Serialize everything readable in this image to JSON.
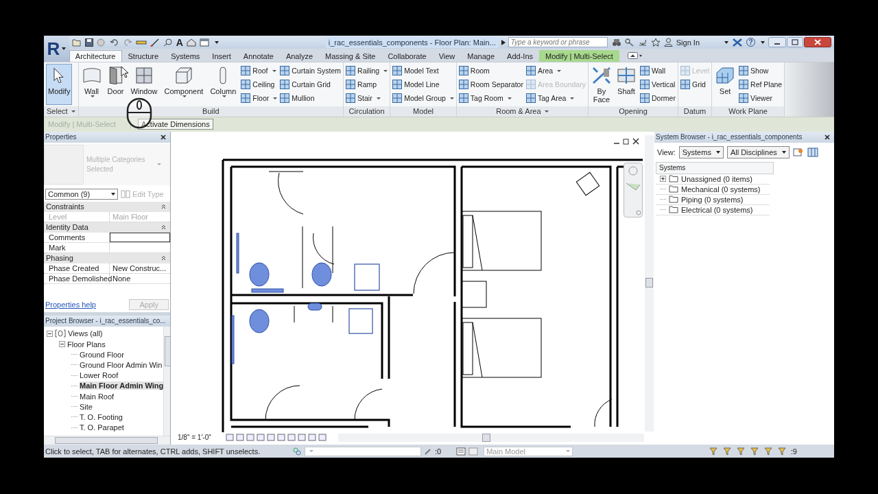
{
  "app": {
    "logo_letter": "R",
    "title": "i_rac_essentials_components - Floor Plan: Main...",
    "search": {
      "placeholder": "Type a keyword or phrase"
    },
    "sign_in": "Sign In",
    "text_tool_glyph": "A",
    "help_glyph": "?"
  },
  "tabs": [
    {
      "label": "Architecture",
      "selected": true,
      "kind": "normal"
    },
    {
      "label": "Structure",
      "selected": false,
      "kind": "normal"
    },
    {
      "label": "Systems",
      "selected": false,
      "kind": "normal"
    },
    {
      "label": "Insert",
      "selected": false,
      "kind": "normal"
    },
    {
      "label": "Annotate",
      "selected": false,
      "kind": "normal"
    },
    {
      "label": "Analyze",
      "selected": false,
      "kind": "normal"
    },
    {
      "label": "Massing & Site",
      "selected": false,
      "kind": "normal"
    },
    {
      "label": "Collaborate",
      "selected": false,
      "kind": "normal"
    },
    {
      "label": "View",
      "selected": false,
      "kind": "normal"
    },
    {
      "label": "Manage",
      "selected": false,
      "kind": "normal"
    },
    {
      "label": "Add-Ins",
      "selected": false,
      "kind": "normal"
    },
    {
      "label": "Modify | Multi-Select",
      "selected": false,
      "kind": "contextual"
    }
  ],
  "ribbon": {
    "panels": [
      {
        "title": "Select",
        "dropdown": true,
        "tools": [
          {
            "label": "Modify",
            "kind": "large",
            "dropdown": false,
            "selected": true,
            "disabled": false
          }
        ]
      },
      {
        "title": "Build",
        "dropdown": false,
        "tools": [
          {
            "label": "Wall",
            "kind": "large",
            "dropdown": true,
            "selected": false,
            "disabled": false
          },
          {
            "label": "Door",
            "kind": "large",
            "dropdown": false,
            "selected": false,
            "disabled": false
          },
          {
            "label": "Window",
            "kind": "large",
            "dropdown": false,
            "selected": false,
            "disabled": false
          },
          {
            "label": "Component",
            "kind": "large",
            "dropdown": true,
            "selected": false,
            "disabled": false
          },
          {
            "label": "Column",
            "kind": "large",
            "dropdown": true,
            "selected": false,
            "disabled": false
          },
          {
            "label": "Roof",
            "kind": "small",
            "dropdown": true,
            "selected": false,
            "disabled": false
          },
          {
            "label": "Ceiling",
            "kind": "small",
            "dropdown": false,
            "selected": false,
            "disabled": false
          },
          {
            "label": "Floor",
            "kind": "small",
            "dropdown": true,
            "selected": false,
            "disabled": false
          },
          {
            "label": "Curtain System",
            "kind": "small",
            "dropdown": false,
            "selected": false,
            "disabled": false
          },
          {
            "label": "Curtain Grid",
            "kind": "small",
            "dropdown": false,
            "selected": false,
            "disabled": false
          },
          {
            "label": "Mullion",
            "kind": "small",
            "dropdown": false,
            "selected": false,
            "disabled": false
          }
        ]
      },
      {
        "title": "Circulation",
        "dropdown": false,
        "tools": [
          {
            "label": "Railing",
            "kind": "small",
            "dropdown": true,
            "selected": false,
            "disabled": false
          },
          {
            "label": "Ramp",
            "kind": "small",
            "dropdown": false,
            "selected": false,
            "disabled": false
          },
          {
            "label": "Stair",
            "kind": "small",
            "dropdown": true,
            "selected": false,
            "disabled": false
          }
        ]
      },
      {
        "title": "Model",
        "dropdown": false,
        "tools": [
          {
            "label": "Model Text",
            "kind": "small",
            "dropdown": false,
            "selected": false,
            "disabled": false
          },
          {
            "label": "Model Line",
            "kind": "small",
            "dropdown": false,
            "selected": false,
            "disabled": false
          },
          {
            "label": "Model Group",
            "kind": "small",
            "dropdown": true,
            "selected": false,
            "disabled": false
          }
        ]
      },
      {
        "title": "Room & Area",
        "dropdown": true,
        "tools": [
          {
            "label": "Room",
            "kind": "small",
            "dropdown": false,
            "selected": false,
            "disabled": false
          },
          {
            "label": "Room Separator",
            "kind": "small",
            "dropdown": false,
            "selected": false,
            "disabled": false
          },
          {
            "label": "Tag Room",
            "kind": "small",
            "dropdown": true,
            "selected": false,
            "disabled": false
          },
          {
            "label": "Area",
            "kind": "small",
            "dropdown": true,
            "selected": false,
            "disabled": false
          },
          {
            "label": "Area Boundary",
            "kind": "small",
            "dropdown": false,
            "selected": false,
            "disabled": true
          },
          {
            "label": "Tag Area",
            "kind": "small",
            "dropdown": true,
            "selected": false,
            "disabled": false
          }
        ]
      },
      {
        "title": "Opening",
        "dropdown": false,
        "tools": [
          {
            "label": "By Face",
            "kind": "large",
            "dropdown": false,
            "selected": false,
            "disabled": false
          },
          {
            "label": "Shaft",
            "kind": "large",
            "dropdown": false,
            "selected": false,
            "disabled": false
          },
          {
            "label": "Wall",
            "kind": "small",
            "dropdown": false,
            "selected": false,
            "disabled": false
          },
          {
            "label": "Vertical",
            "kind": "small",
            "dropdown": false,
            "selected": false,
            "disabled": false
          },
          {
            "label": "Dormer",
            "kind": "small",
            "dropdown": false,
            "selected": false,
            "disabled": false
          }
        ]
      },
      {
        "title": "Datum",
        "dropdown": false,
        "tools": [
          {
            "label": "Level",
            "kind": "small",
            "dropdown": false,
            "selected": false,
            "disabled": true
          },
          {
            "label": "Grid",
            "kind": "small",
            "dropdown": false,
            "selected": false,
            "disabled": false
          }
        ]
      },
      {
        "title": "Work Plane",
        "dropdown": false,
        "tools": [
          {
            "label": "Set",
            "kind": "large",
            "dropdown": false,
            "selected": false,
            "disabled": false
          },
          {
            "label": "Show",
            "kind": "small",
            "dropdown": false,
            "selected": false,
            "disabled": false
          },
          {
            "label": "Ref Plane",
            "kind": "small",
            "dropdown": false,
            "selected": false,
            "disabled": false
          },
          {
            "label": "Viewer",
            "kind": "small",
            "dropdown": false,
            "selected": false,
            "disabled": false
          }
        ]
      }
    ]
  },
  "options_bar": {
    "context": "Modify | Multi-Select",
    "button": "Activate Dimensions"
  },
  "properties": {
    "title": "Properties",
    "type_name": "Multiple Categories Selected",
    "filter": "Common (9)",
    "edit_type": "Edit Type",
    "groups": [
      {
        "name": "Constraints",
        "rows": [
          {
            "label": "Level",
            "value": "Main Floor",
            "disabled": true,
            "selected": false
          }
        ]
      },
      {
        "name": "Identity Data",
        "rows": [
          {
            "label": "Comments",
            "disabled": false,
            "selected": true
          },
          {
            "label": "Mark",
            "disabled": false,
            "selected": false
          }
        ]
      },
      {
        "name": "Phasing",
        "rows": [
          {
            "label": "Phase Created",
            "value": "New Construc...",
            "disabled": false,
            "selected": false
          },
          {
            "label": "Phase Demolished",
            "value": "None",
            "disabled": false,
            "selected": false
          }
        ]
      }
    ],
    "help": "Properties help",
    "apply": "Apply"
  },
  "project_browser": {
    "title": "Project Browser - i_rac_essentials_co...",
    "tree": [
      {
        "label": "Views (all)",
        "kind": "group",
        "expanded": true,
        "selected": false,
        "children": [
          {
            "label": "Floor Plans",
            "kind": "group",
            "expanded": true,
            "selected": false,
            "children": [
              {
                "label": "Ground Floor",
                "kind": "leaf",
                "selected": false
              },
              {
                "label": "Ground Floor Admin Win",
                "kind": "leaf",
                "selected": false
              },
              {
                "label": "Lower Roof",
                "kind": "leaf",
                "selected": false
              },
              {
                "label": "Main Floor Admin Wing",
                "kind": "leaf",
                "selected": true
              },
              {
                "label": "Main Roof",
                "kind": "leaf",
                "selected": false
              },
              {
                "label": "Site",
                "kind": "leaf",
                "selected": false
              },
              {
                "label": "T. O. Footing",
                "kind": "leaf",
                "selected": false
              },
              {
                "label": "T. O. Parapet",
                "kind": "leaf",
                "selected": false
              }
            ]
          }
        ]
      }
    ]
  },
  "view": {
    "scale": "1/8\" = 1'-0\""
  },
  "system_browser": {
    "title": "System Browser - i_rac_essentials_components",
    "view_label": "View:",
    "view_mode": "Systems",
    "discipline": "All Disciplines",
    "column": "Systems",
    "tree": [
      {
        "label": "Unassigned (0 items)",
        "kind": "group",
        "expanded": false
      },
      {
        "label": "Mechanical (0 systems)",
        "kind": "leaf"
      },
      {
        "label": "Piping (0 systems)",
        "kind": "leaf"
      },
      {
        "label": "Electrical (0 systems)",
        "kind": "leaf"
      }
    ]
  },
  "status_bar": {
    "message": "Click to select, TAB for alternates, CTRL adds, SHIFT unselects.",
    "editable_count": ":0",
    "model": "Main Model",
    "selection_count": ":9"
  }
}
